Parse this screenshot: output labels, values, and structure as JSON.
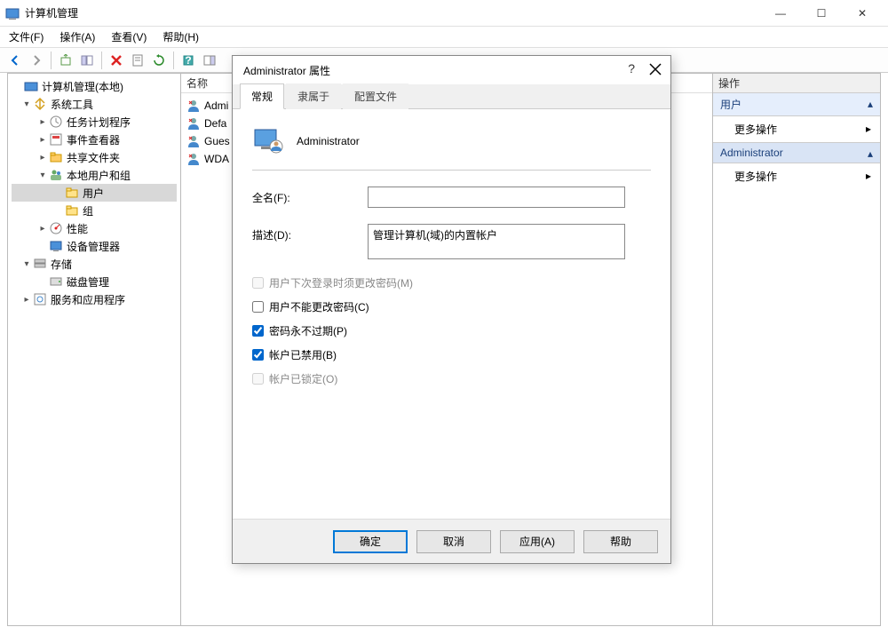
{
  "window": {
    "title": "计算机管理",
    "minimize": "—",
    "maximize": "☐",
    "close": "✕"
  },
  "menubar": {
    "file": "文件(F)",
    "action": "操作(A)",
    "view": "查看(V)",
    "help": "帮助(H)"
  },
  "tree": {
    "root": "计算机管理(本地)",
    "system_tools": "系统工具",
    "task_scheduler": "任务计划程序",
    "event_viewer": "事件查看器",
    "shared_folders": "共享文件夹",
    "local_users_groups": "本地用户和组",
    "users": "用户",
    "groups": "组",
    "performance": "性能",
    "device_manager": "设备管理器",
    "storage": "存储",
    "disk_management": "磁盘管理",
    "services_apps": "服务和应用程序"
  },
  "name_column": "名称",
  "users_list": [
    {
      "name": "Admi"
    },
    {
      "name": "Defa"
    },
    {
      "name": "Gues"
    },
    {
      "name": "WDA"
    }
  ],
  "actions": {
    "header": "操作",
    "user_section": "用户",
    "more_actions": "更多操作",
    "admin_section": "Administrator"
  },
  "dialog": {
    "title": "Administrator 属性",
    "tabs": {
      "general": "常规",
      "memberof": "隶属于",
      "profile": "配置文件"
    },
    "username": "Administrator",
    "fullname_label": "全名(F):",
    "fullname_value": "",
    "description_label": "描述(D):",
    "description_value": "管理计算机(域)的内置帐户",
    "chk_must_change": "用户下次登录时须更改密码(M)",
    "chk_cannot_change": "用户不能更改密码(C)",
    "chk_never_expire": "密码永不过期(P)",
    "chk_disabled": "帐户已禁用(B)",
    "chk_locked": "帐户已锁定(O)",
    "btn_ok": "确定",
    "btn_cancel": "取消",
    "btn_apply": "应用(A)",
    "btn_help": "帮助"
  }
}
